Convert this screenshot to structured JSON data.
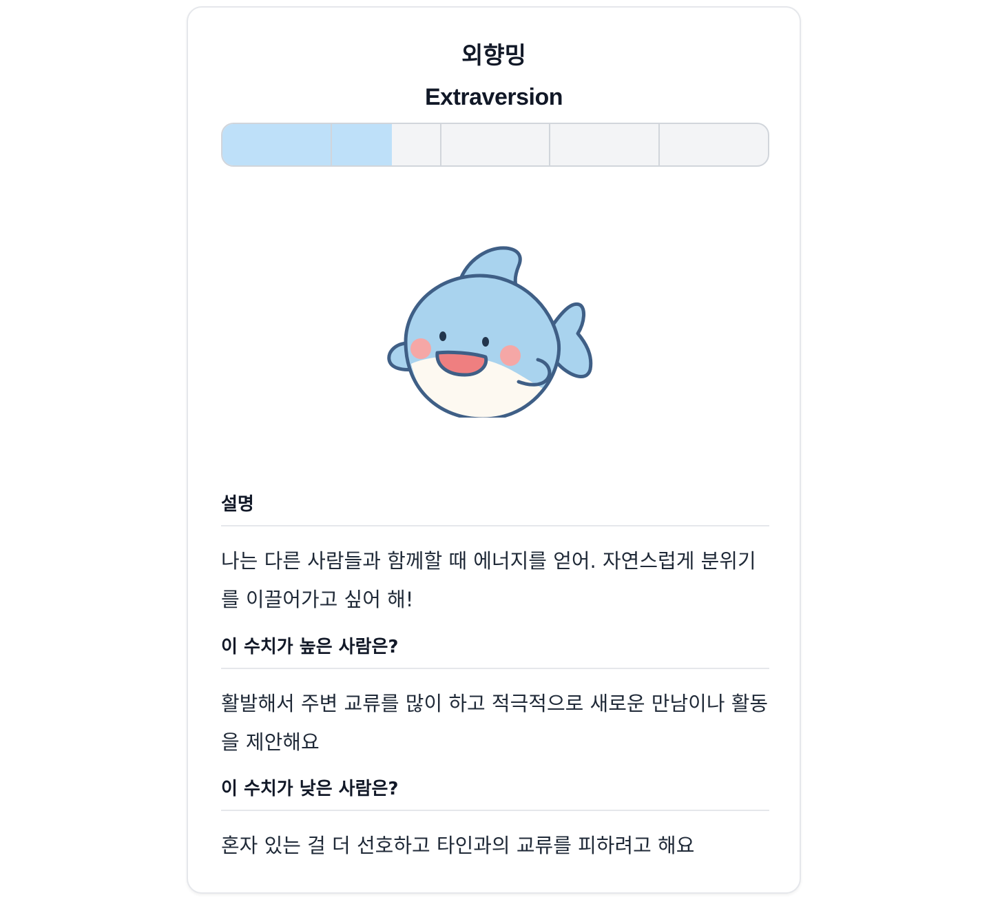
{
  "card": {
    "title_ko": "외향밍",
    "title_en": "Extraversion"
  },
  "score_bar": {
    "segments": 5,
    "fill_fraction": 0.31,
    "fill_color": "#bee0f9",
    "track_color": "#f3f4f6"
  },
  "mascot": {
    "icon": "dolphin-mascot-icon",
    "body_color": "#a9d3ee",
    "belly_color": "#fdf9f1",
    "cheek_color": "#f5a7a6",
    "outline_color": "#3f5f86"
  },
  "sections": [
    {
      "heading": "설명",
      "body": "나는 다른 사람들과 함께할 때 에너지를 얻어. 자연스럽게 분위기를 이끌어가고 싶어 해!"
    },
    {
      "heading": "이 수치가 높은 사람은?",
      "body": "활발해서 주변 교류를 많이 하고 적극적으로 새로운 만남이나 활동을 제안해요"
    },
    {
      "heading": "이 수치가 낮은 사람은?",
      "body": "혼자 있는 걸 더 선호하고 타인과의 교류를 피하려고 해요"
    }
  ]
}
